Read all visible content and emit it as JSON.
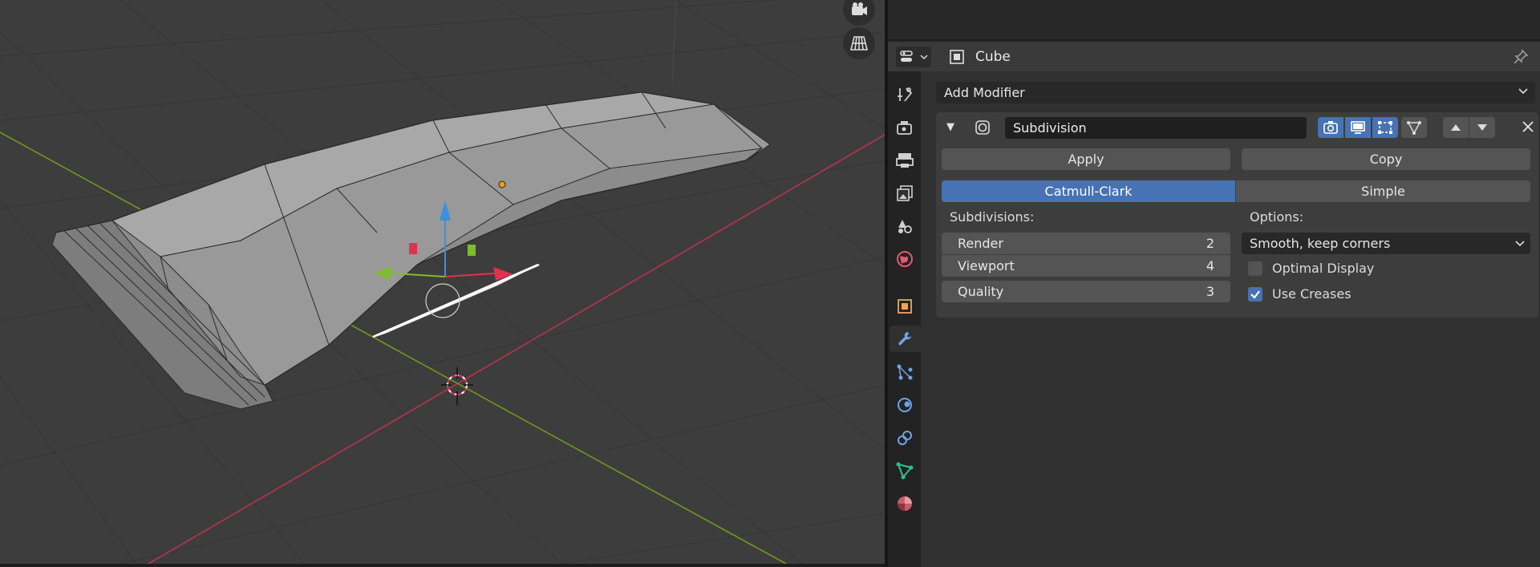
{
  "header": {
    "object_name": "Cube"
  },
  "add_modifier": {
    "label": "Add Modifier"
  },
  "modifier": {
    "name": "Subdivision",
    "apply_label": "Apply",
    "copy_label": "Copy",
    "methods": [
      "Catmull-Clark",
      "Simple"
    ],
    "selected_method": "Catmull-Clark",
    "subdivisions_label": "Subdivisions:",
    "render_label": "Render",
    "render_value": "2",
    "viewport_label": "Viewport",
    "viewport_value": "4",
    "quality_label": "Quality",
    "quality_value": "3",
    "options_label": "Options:",
    "uv_smooth": "Smooth, keep corners",
    "optimal_display_label": "Optimal Display",
    "optimal_display": false,
    "use_creases_label": "Use Creases",
    "use_creases": true
  },
  "tabs": [
    "tool",
    "render",
    "output",
    "view-layer",
    "scene",
    "world",
    "object",
    "modifiers",
    "particles",
    "physics",
    "constraints",
    "data",
    "material"
  ],
  "active_tab": "modifiers",
  "colors": {
    "accent": "#4772b3",
    "viewport_bg": "#3d3d3d",
    "x_axis": "#b9334a",
    "y_axis": "#6f9a1b"
  },
  "icons": {
    "camera": "camera-icon",
    "grid": "perspective-grid-icon"
  }
}
